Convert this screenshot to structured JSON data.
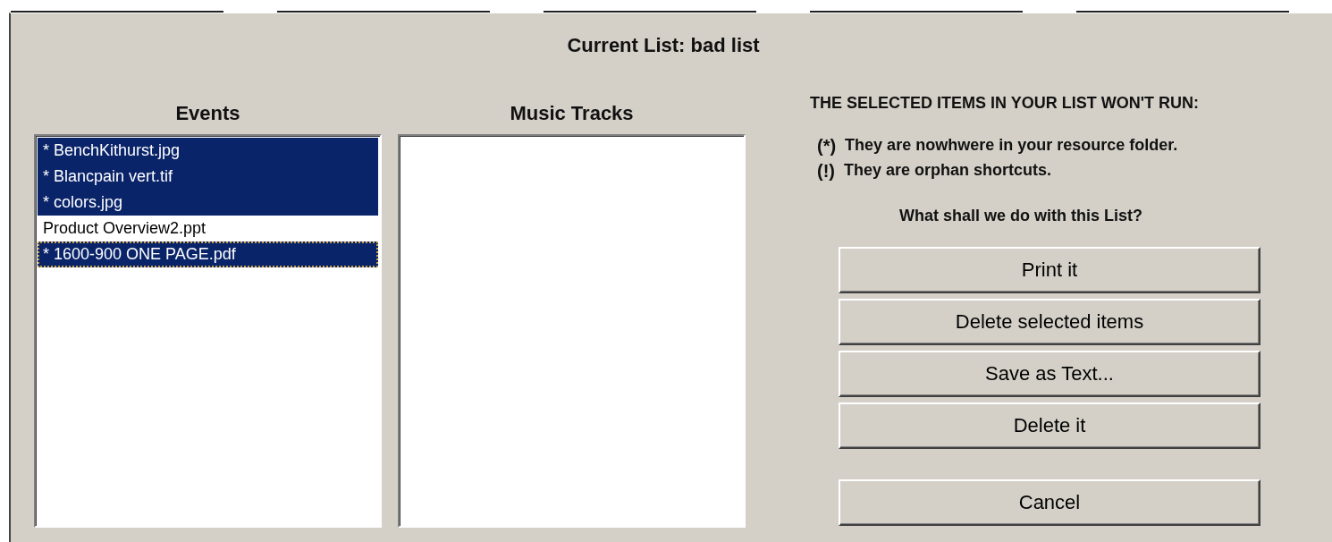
{
  "dialog": {
    "title": "Current List: bad list"
  },
  "lists": [
    {
      "heading": "Events",
      "items": [
        {
          "label": "* BenchKithurst.jpg",
          "selected": true,
          "focused": false
        },
        {
          "label": "* Blancpain vert.tif",
          "selected": true,
          "focused": false
        },
        {
          "label": "* colors.jpg",
          "selected": true,
          "focused": false
        },
        {
          "label": "Product Overview2.ppt",
          "selected": false,
          "focused": false
        },
        {
          "label": "* 1600-900 ONE PAGE.pdf",
          "selected": true,
          "focused": true
        }
      ]
    },
    {
      "heading": "Music Tracks"
    }
  ],
  "warning": "THE SELECTED ITEMS IN YOUR LIST WON'T RUN:",
  "legend": [
    {
      "marker": "(*)",
      "text": "They are nowhwere in your resource folder."
    },
    {
      "marker": "(!)",
      "text": "They are orphan shortcuts."
    }
  ],
  "question": "What shall we do with this List?",
  "buttons": [
    {
      "label": "Print it",
      "kind": "action"
    },
    {
      "label": "Delete selected items",
      "kind": "action"
    },
    {
      "label": "Save as Text...",
      "kind": "action"
    },
    {
      "label": "Delete it",
      "kind": "action"
    },
    {
      "label": "Cancel",
      "kind": "cancel"
    }
  ]
}
